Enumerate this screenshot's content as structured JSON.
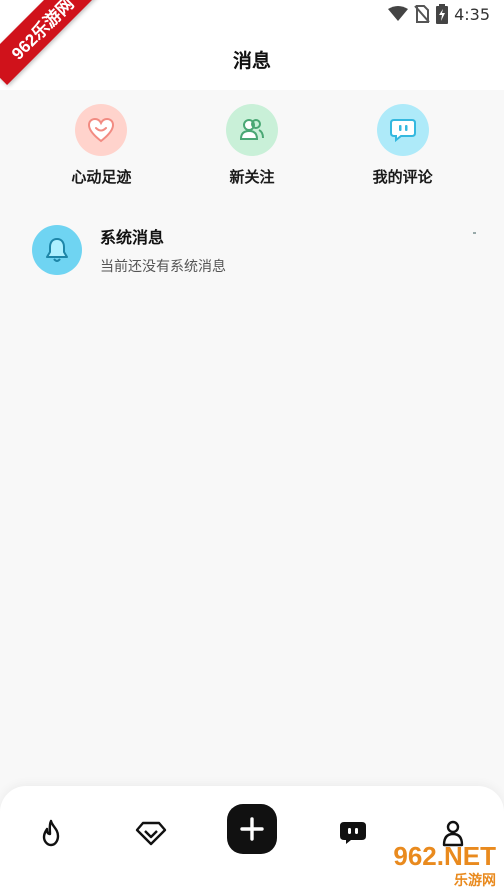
{
  "status": {
    "time": "4:35"
  },
  "watermark": {
    "corner_text": "962乐游网",
    "logo_top": "962.NET",
    "logo_bottom": "乐游网"
  },
  "header": {
    "title": "消息"
  },
  "quick": [
    {
      "label": "心动足迹",
      "icon": "heart-smile-icon",
      "bg": "#ffd3cc",
      "fg": "#f28b82"
    },
    {
      "label": "新关注",
      "icon": "users-icon",
      "bg": "#c9f0d8",
      "fg": "#4aa774"
    },
    {
      "label": "我的评论",
      "icon": "chat-dots-icon",
      "bg": "#aeeaf9",
      "fg": "#34b8df"
    }
  ],
  "messages": [
    {
      "title": "系统消息",
      "subtitle": "当前还没有系统消息",
      "icon": "bell-icon"
    }
  ],
  "tabbar": {
    "items": [
      {
        "name": "hot",
        "icon": "flame-icon"
      },
      {
        "name": "discover",
        "icon": "diamond-icon"
      },
      {
        "name": "add",
        "icon": "plus-icon"
      },
      {
        "name": "messages",
        "icon": "message-icon"
      },
      {
        "name": "profile",
        "icon": "person-icon"
      }
    ]
  }
}
